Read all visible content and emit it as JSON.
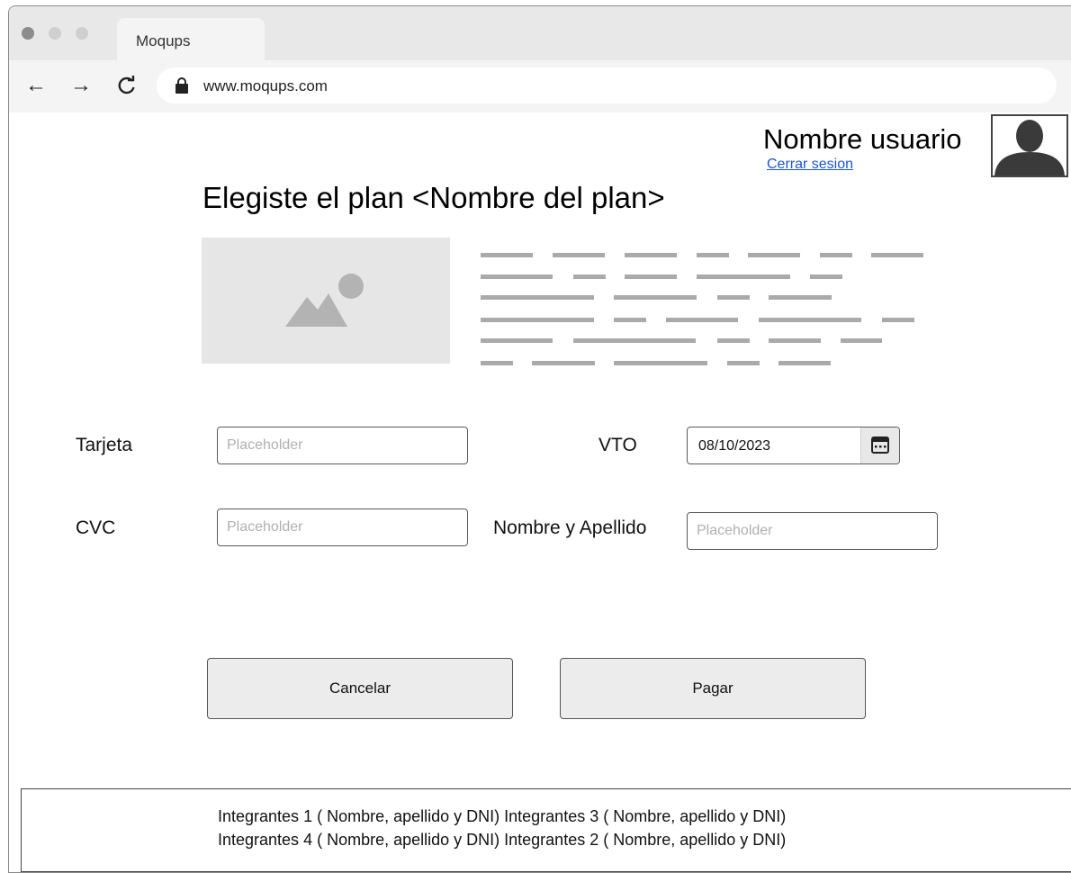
{
  "browser": {
    "tab_title": "Moqups",
    "url": "www.moqups.com",
    "traffic_lights": [
      "#8c8c8c",
      "#cfcfcf",
      "#cfcfcf"
    ],
    "icons": {
      "back": "arrow-left-icon",
      "forward": "arrow-right-icon",
      "reload": "reload-icon",
      "lock": "lock-icon"
    }
  },
  "header": {
    "username": "Nombre usuario",
    "logout_link": "Cerrar sesion",
    "avatar_icon": "user-avatar-icon"
  },
  "plan": {
    "title": "Elegiste el plan <Nombre del plan>",
    "image_icon": "image-placeholder-icon"
  },
  "form": {
    "card_label": "Tarjeta",
    "card_placeholder": "Placeholder",
    "expiry_label": "VTO",
    "expiry_value": "08/10/2023",
    "calendar_icon": "calendar-icon",
    "cvc_label": "CVC",
    "cvc_placeholder": "Placeholder",
    "name_label": "Nombre y Apellido",
    "name_placeholder": "Placeholder"
  },
  "actions": {
    "cancel_label": "Cancelar",
    "pay_label": "Pagar"
  },
  "footer": {
    "line1": "Integrantes 1 ( Nombre, apellido y DNI) Integrantes 3 ( Nombre, apellido y DNI)",
    "line2": "Integrantes 4 ( Nombre, apellido y DNI) Integrantes 2 ( Nombre, apellido y DNI)"
  },
  "colors": {
    "link": "#1a55d6",
    "placeholder_gray": "#e6e6e6",
    "text_line_gray": "#aaaaaa"
  }
}
